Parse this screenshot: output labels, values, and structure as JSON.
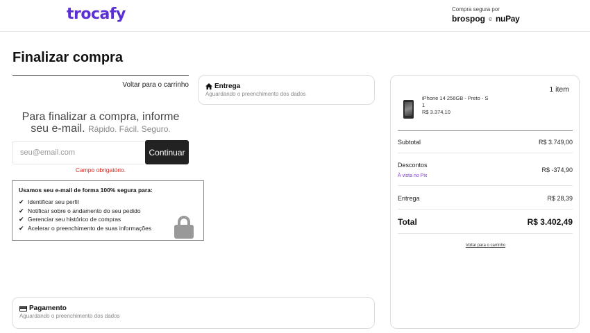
{
  "header": {
    "logo": "trocafy",
    "secure_label": "Compra segura por",
    "brand_1": "brospog",
    "brand_sep": "e",
    "brand_2": "nuPay"
  },
  "page": {
    "title": "Finalizar compra",
    "back_to_cart": "Voltar para o carrinho"
  },
  "email_step": {
    "heading": "Para finalizar a compra, informe seu e-mail.",
    "subheading": "Rápido. Fácil. Seguro.",
    "placeholder": "seu@email.com",
    "button_label": "Continuar",
    "error": "Campo obrigatório."
  },
  "secure_box": {
    "title": "Usamos seu e-mail de forma 100% segura para:",
    "items": [
      "Identificar seu perfil",
      "Notificar sobre o andamento do seu pedido",
      "Gerenciar seu histórico de compras",
      "Acelerar o preenchimento de suas informações"
    ]
  },
  "entrega": {
    "title": "Entrega",
    "status": "Aguardando o preenchimento dos dados"
  },
  "pagamento": {
    "title": "Pagamento",
    "status": "Aguardando o preenchimento dos dados"
  },
  "summary": {
    "item_count": "1 item",
    "product": {
      "name": "iPhone 14 256GB - Preto - S",
      "quantity": "1",
      "price": "R$ 3.374,10"
    },
    "subtotal_label": "Subtotal",
    "subtotal_value": "R$ 3.749,00",
    "discount_label": "Descontos",
    "discount_note": "À vista no Pix",
    "discount_value": "R$ -374,90",
    "delivery_label": "Entrega",
    "delivery_value": "R$ 28,39",
    "total_label": "Total",
    "total_value": "R$ 3.402,49",
    "back_to_cart": "Voltar para o carrinho"
  },
  "colors": {
    "brand": "#5b2fd6",
    "error": "#d9261c",
    "pix": "#7b3fc8",
    "button": "#222222"
  }
}
